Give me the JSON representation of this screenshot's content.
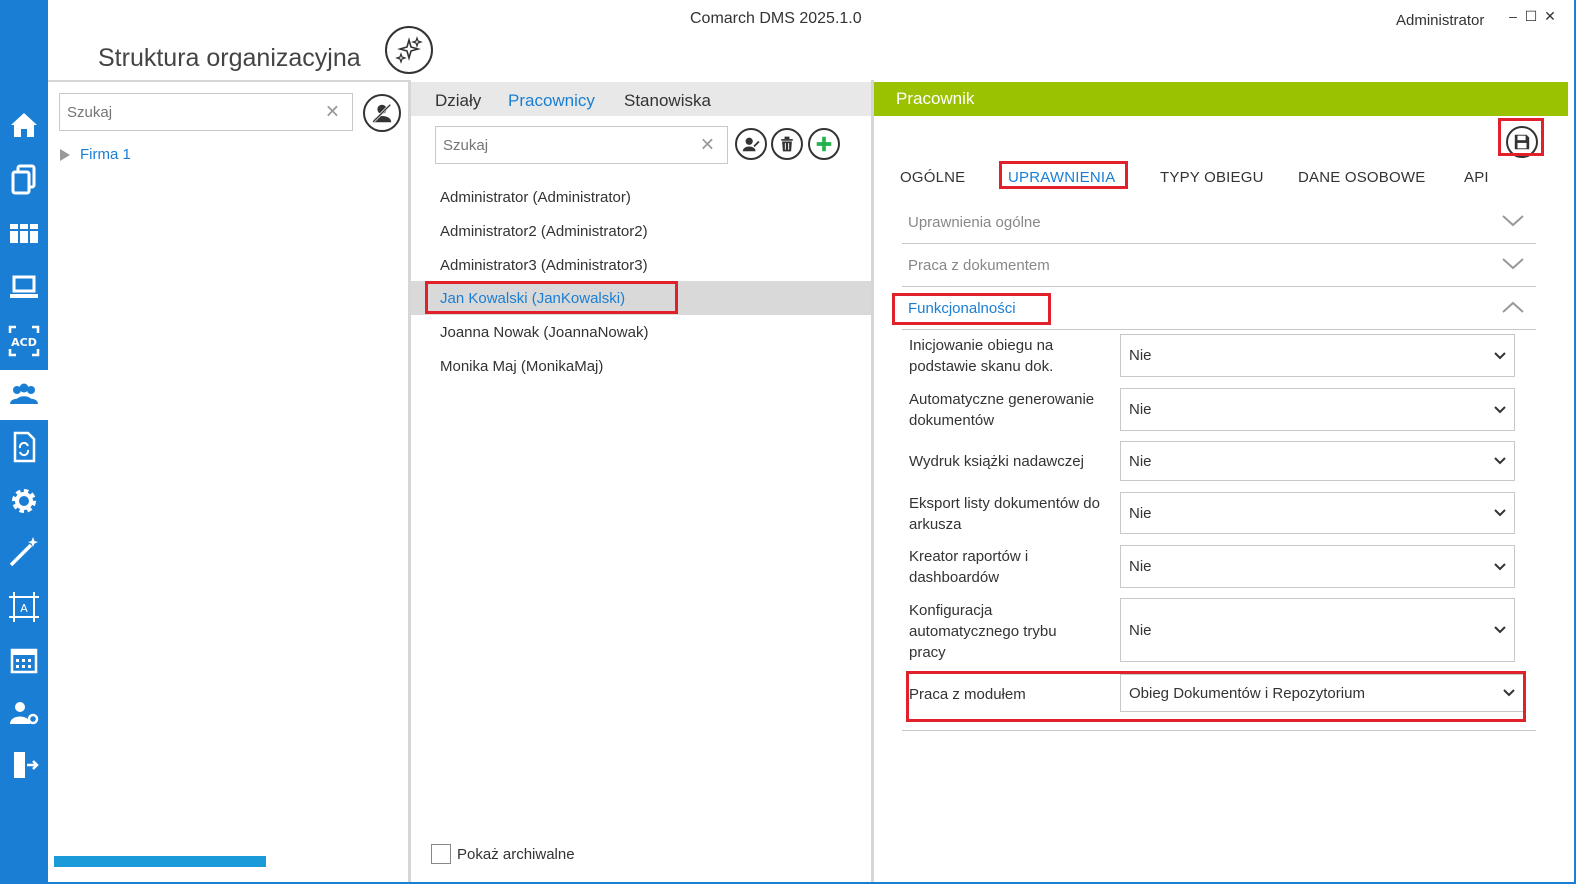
{
  "window": {
    "title": "Comarch DMS 2025.1.0",
    "user": "Administrator",
    "minimize": "–",
    "maximize": "☐",
    "close": "✕"
  },
  "page": {
    "title": "Struktura organizacyjna"
  },
  "sidebar": {
    "items": [
      {
        "name": "home-icon"
      },
      {
        "name": "documents-icon"
      },
      {
        "name": "repository-icon"
      },
      {
        "name": "computer-icon"
      },
      {
        "name": "acd-icon",
        "label": "ACD"
      },
      {
        "name": "organization-icon",
        "active": true
      },
      {
        "name": "workflow-icon"
      },
      {
        "name": "settings-gear-icon"
      },
      {
        "name": "magic-wand-icon"
      },
      {
        "name": "template-editor-icon"
      },
      {
        "name": "calendar-icon"
      },
      {
        "name": "user-settings-icon"
      },
      {
        "name": "logout-icon"
      }
    ]
  },
  "structure": {
    "search_placeholder": "Szukaj",
    "tree": [
      {
        "label": "Firma 1"
      }
    ],
    "progress": 1.0
  },
  "employees": {
    "tabs": [
      "Działy",
      "Pracownicy",
      "Stanowiska"
    ],
    "active_tab": "Pracownicy",
    "search_placeholder": "Szukaj",
    "list": [
      "Administrator (Administrator)",
      "Administrator2 (Administrator2)",
      "Administrator3 (Administrator3)",
      "Jan Kowalski (JanKowalski)",
      "Joanna Nowak (JoannaNowak)",
      "Monika Maj (MonikaMaj)"
    ],
    "selected": "Jan Kowalski (JanKowalski)",
    "show_archived_label": "Pokaż archiwalne"
  },
  "employee_detail": {
    "header": "Pracownik",
    "tabs": [
      "OGÓLNE",
      "UPRAWNIENIA",
      "TYPY OBIEGU",
      "DANE OSOBOWE",
      "API"
    ],
    "active_tab": "UPRAWNIENIA",
    "sections": [
      "Uprawnienia ogólne",
      "Praca z dokumentem",
      "Funkcjonalności"
    ],
    "open_section": "Funkcjonalności",
    "permissions": [
      {
        "label": "Inicjowanie obiegu na podstawie skanu dok.",
        "value": "Nie"
      },
      {
        "label": "Automatyczne generowanie dokumentów",
        "value": "Nie"
      },
      {
        "label": "Wydruk książki nadawczej",
        "value": "Nie"
      },
      {
        "label": "Eksport listy dokumentów do arkusza",
        "value": "Nie"
      },
      {
        "label": "Kreator raportów i dashboardów",
        "value": "Nie"
      },
      {
        "label": "Konfiguracja automatycznego trybu pracy",
        "value": "Nie"
      },
      {
        "label": "Praca z modułem",
        "value": "Obieg Dokumentów i Repozytorium"
      }
    ]
  },
  "colors": {
    "accent": "#1a7fd4",
    "header_green": "#9bc200",
    "highlight_red": "#e0202a",
    "add_green": "#22b14c"
  }
}
